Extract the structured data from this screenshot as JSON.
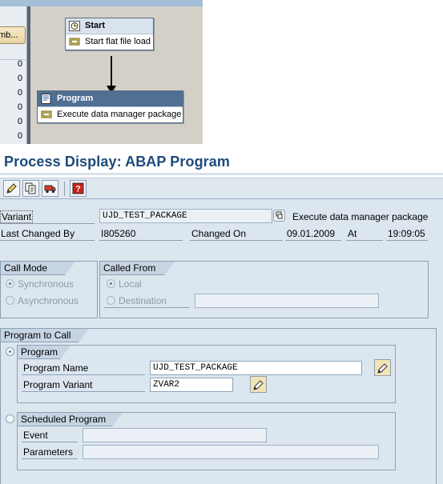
{
  "chain": {
    "left_button_label": "mb...",
    "left_values": [
      "0",
      "0",
      "0",
      "0",
      "0",
      "0"
    ],
    "start_node": {
      "title": "Start",
      "description": "Start flat file load"
    },
    "program_node": {
      "title": "Program",
      "description": "Execute data manager package"
    }
  },
  "page_title": "Process Display: ABAP Program",
  "toolbar": {
    "icons": [
      "edit-pencil-icon",
      "copy-icon",
      "transport-truck-icon",
      "help-icon"
    ]
  },
  "header": {
    "variant_label": "Variant",
    "variant_value": "UJD_TEST_PACKAGE",
    "variant_description": "Execute data manager package",
    "last_changed_by_label": "Last Changed By",
    "last_changed_by_value": "I805260",
    "changed_on_label": "Changed On",
    "changed_on_value": "09.01.2009",
    "at_label": "At",
    "at_value": "19:09:05"
  },
  "call_mode": {
    "title": "Call Mode",
    "options": [
      "Synchronous",
      "Asynchronous"
    ],
    "selected": "Synchronous"
  },
  "called_from": {
    "title": "Called From",
    "local_label": "Local",
    "destination_label": "Destination",
    "destination_value": "",
    "selected": "Local"
  },
  "program_to_call": {
    "title": "Program to Call",
    "program": {
      "title": "Program",
      "selected": true,
      "name_label": "Program Name",
      "name_value": "UJD_TEST_PACKAGE",
      "variant_label": "Program Variant",
      "variant_value": "ZVAR2"
    },
    "scheduled": {
      "title": "Scheduled Program",
      "selected": false,
      "event_label": "Event",
      "event_value": "",
      "parameters_label": "Parameters",
      "parameters_value": ""
    }
  },
  "colors": {
    "title": "#1e4a7a",
    "form_background": "#dce6ef",
    "active_node_header": "#4f6f93"
  }
}
